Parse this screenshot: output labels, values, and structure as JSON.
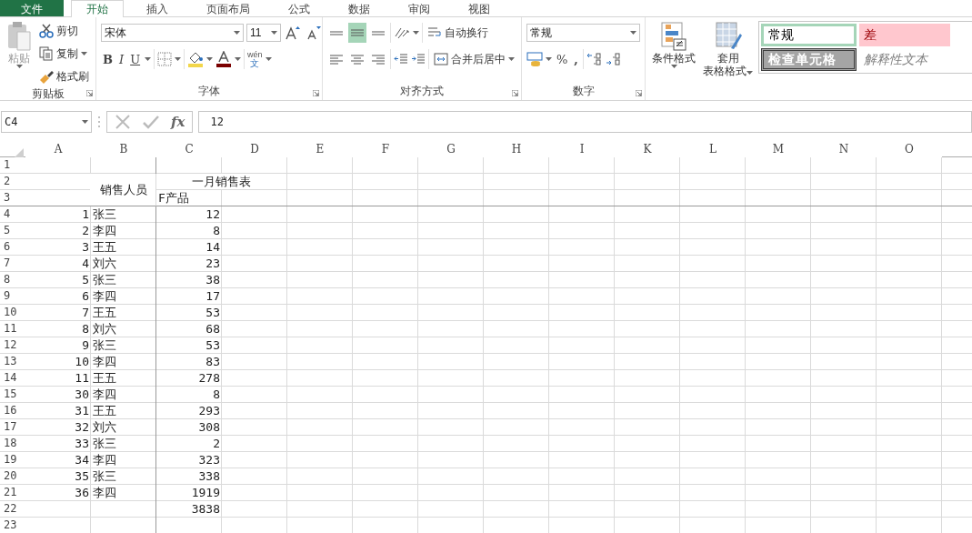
{
  "tabs": [
    {
      "label": "文件",
      "selected": false,
      "kind": "file"
    },
    {
      "label": "开始",
      "selected": true,
      "kind": "tab"
    },
    {
      "label": "插入",
      "selected": false,
      "kind": "tab"
    },
    {
      "label": "页面布局",
      "selected": false,
      "kind": "tab"
    },
    {
      "label": "公式",
      "selected": false,
      "kind": "tab"
    },
    {
      "label": "数据",
      "selected": false,
      "kind": "tab"
    },
    {
      "label": "审阅",
      "selected": false,
      "kind": "tab"
    },
    {
      "label": "视图",
      "selected": false,
      "kind": "tab"
    }
  ],
  "ribbon": {
    "clipboard": {
      "paste": "粘贴",
      "cut": "剪切",
      "copy": "复制",
      "format_painter": "格式刷",
      "label": "剪贴板",
      "paste_disabled": true
    },
    "font": {
      "font_name": "宋体",
      "font_size": "11",
      "bold": "B",
      "italic": "I",
      "underline": "U",
      "phonetic_top": "wén",
      "phonetic_bottom": "文",
      "label": "字体"
    },
    "alignment": {
      "vertical": [
        {
          "selected": false
        },
        {
          "selected": true
        },
        {
          "selected": false
        }
      ],
      "horizontal": [
        {
          "selected": false
        },
        {
          "selected": false
        },
        {
          "selected": false
        }
      ],
      "wrap_text": "自动换行",
      "merge_center": "合并后居中",
      "label": "对齐方式"
    },
    "number": {
      "format": "常规",
      "percent": "%",
      "comma": ",",
      "label": "数字"
    },
    "styles": {
      "conditional_format": "条件格式",
      "table_format_top": "套用",
      "table_format_bottom": "表格格式",
      "gallery": [
        {
          "label": "常规",
          "kind": "normal"
        },
        {
          "label": "差",
          "kind": "bad"
        },
        {
          "label": "检查单元格",
          "kind": "check"
        },
        {
          "label": "解释性文本",
          "kind": "explanatory"
        }
      ]
    }
  },
  "formula_bar": {
    "name_box": "C4",
    "formula": "12",
    "function_symbol": "fx"
  },
  "sheet": {
    "columns": [
      "A",
      "B",
      "C",
      "D",
      "E",
      "F",
      "G",
      "H",
      "I",
      "K",
      "L",
      "M",
      "N",
      "O"
    ],
    "rows": [
      {
        "number": "1",
        "cells": []
      },
      {
        "number": "2",
        "cells": [
          null,
          {
            "kind": "merged_down",
            "value": "销售人员"
          },
          {
            "kind": "merged_across",
            "value": "一月销售表"
          }
        ]
      },
      {
        "number": "3",
        "cells": [
          null,
          null,
          {
            "kind": "text",
            "value": "F产品"
          }
        ]
      },
      {
        "number": "4",
        "cells": [
          {
            "kind": "number",
            "value": "1"
          },
          {
            "kind": "text",
            "value": "张三"
          },
          {
            "kind": "number",
            "value": "12"
          }
        ]
      },
      {
        "number": "5",
        "cells": [
          {
            "kind": "number",
            "value": "2"
          },
          {
            "kind": "text",
            "value": "李四"
          },
          {
            "kind": "number",
            "value": "8"
          }
        ]
      },
      {
        "number": "6",
        "cells": [
          {
            "kind": "number",
            "value": "3"
          },
          {
            "kind": "text",
            "value": "王五"
          },
          {
            "kind": "number",
            "value": "14"
          }
        ]
      },
      {
        "number": "7",
        "cells": [
          {
            "kind": "number",
            "value": "4"
          },
          {
            "kind": "text",
            "value": "刘六"
          },
          {
            "kind": "number",
            "value": "23"
          }
        ]
      },
      {
        "number": "8",
        "cells": [
          {
            "kind": "number",
            "value": "5"
          },
          {
            "kind": "text",
            "value": "张三"
          },
          {
            "kind": "number",
            "value": "38"
          }
        ]
      },
      {
        "number": "9",
        "cells": [
          {
            "kind": "number",
            "value": "6"
          },
          {
            "kind": "text",
            "value": "李四"
          },
          {
            "kind": "number",
            "value": "17"
          }
        ]
      },
      {
        "number": "10",
        "cells": [
          {
            "kind": "number",
            "value": "7"
          },
          {
            "kind": "text",
            "value": "王五"
          },
          {
            "kind": "number",
            "value": "53"
          }
        ]
      },
      {
        "number": "11",
        "cells": [
          {
            "kind": "number",
            "value": "8"
          },
          {
            "kind": "text",
            "value": "刘六"
          },
          {
            "kind": "number",
            "value": "68"
          }
        ]
      },
      {
        "number": "12",
        "cells": [
          {
            "kind": "number",
            "value": "9"
          },
          {
            "kind": "text",
            "value": "张三"
          },
          {
            "kind": "number",
            "value": "53"
          }
        ]
      },
      {
        "number": "13",
        "cells": [
          {
            "kind": "number",
            "value": "10"
          },
          {
            "kind": "text",
            "value": "李四"
          },
          {
            "kind": "number",
            "value": "83"
          }
        ]
      },
      {
        "number": "14",
        "cells": [
          {
            "kind": "number",
            "value": "11"
          },
          {
            "kind": "text",
            "value": "王五"
          },
          {
            "kind": "number",
            "value": "278"
          }
        ]
      },
      {
        "number": "15",
        "cells": [
          {
            "kind": "number",
            "value": "30"
          },
          {
            "kind": "text",
            "value": "李四"
          },
          {
            "kind": "number",
            "value": "8"
          }
        ]
      },
      {
        "number": "16",
        "cells": [
          {
            "kind": "number",
            "value": "31"
          },
          {
            "kind": "text",
            "value": "王五"
          },
          {
            "kind": "number",
            "value": "293"
          }
        ]
      },
      {
        "number": "17",
        "cells": [
          {
            "kind": "number",
            "value": "32"
          },
          {
            "kind": "text",
            "value": "刘六"
          },
          {
            "kind": "number",
            "value": "308"
          }
        ]
      },
      {
        "number": "18",
        "cells": [
          {
            "kind": "number",
            "value": "33"
          },
          {
            "kind": "text",
            "value": "张三"
          },
          {
            "kind": "number",
            "value": "2"
          }
        ]
      },
      {
        "number": "19",
        "cells": [
          {
            "kind": "number",
            "value": "34"
          },
          {
            "kind": "text",
            "value": "李四"
          },
          {
            "kind": "number",
            "value": "323"
          }
        ]
      },
      {
        "number": "20",
        "cells": [
          {
            "kind": "number",
            "value": "35"
          },
          {
            "kind": "text",
            "value": "张三"
          },
          {
            "kind": "number",
            "value": "338"
          }
        ]
      },
      {
        "number": "21",
        "cells": [
          {
            "kind": "number",
            "value": "36"
          },
          {
            "kind": "text",
            "value": "李四"
          },
          {
            "kind": "number",
            "value": "1919"
          }
        ]
      },
      {
        "number": "22",
        "cells": [
          null,
          null,
          {
            "kind": "number",
            "value": "3838"
          }
        ]
      },
      {
        "number": "23",
        "cells": []
      }
    ]
  }
}
